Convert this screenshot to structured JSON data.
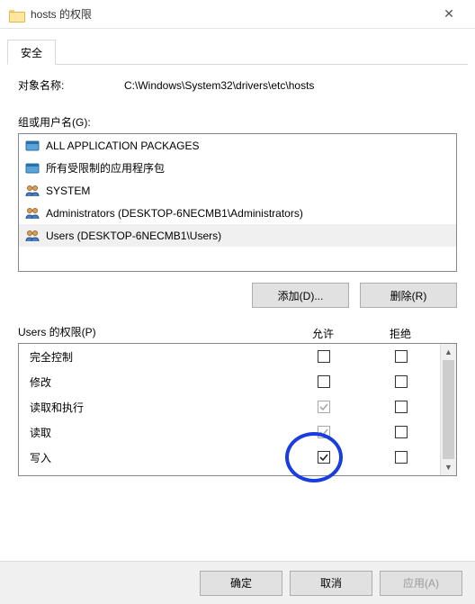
{
  "window": {
    "title": "hosts 的权限",
    "close_glyph": "✕"
  },
  "tabs": {
    "security": "安全"
  },
  "object": {
    "label": "对象名称:",
    "path": "C:\\Windows\\System32\\drivers\\etc\\hosts"
  },
  "groups": {
    "label": "组或用户名(G):",
    "items": [
      {
        "name": "ALL APPLICATION PACKAGES",
        "icon": "package"
      },
      {
        "name": "所有受限制的应用程序包",
        "icon": "package"
      },
      {
        "name": "SYSTEM",
        "icon": "users"
      },
      {
        "name": "Administrators (DESKTOP-6NECMB1\\Administrators)",
        "icon": "users"
      },
      {
        "name": "Users (DESKTOP-6NECMB1\\Users)",
        "icon": "users",
        "selected": true
      }
    ],
    "add_btn": "添加(D)...",
    "remove_btn": "删除(R)"
  },
  "perms": {
    "label": "Users 的权限(P)",
    "col_allow": "允许",
    "col_deny": "拒绝",
    "rows": [
      {
        "name": "完全控制",
        "allow": false,
        "deny": false,
        "disabled": false
      },
      {
        "name": "修改",
        "allow": false,
        "deny": false,
        "disabled": false
      },
      {
        "name": "读取和执行",
        "allow": true,
        "deny": false,
        "disabled": true
      },
      {
        "name": "读取",
        "allow": true,
        "deny": false,
        "disabled": true
      },
      {
        "name": "写入",
        "allow": true,
        "deny": false,
        "disabled": false
      }
    ],
    "scroll_up": "▲",
    "scroll_down": "▼"
  },
  "footer": {
    "ok": "确定",
    "cancel": "取消",
    "apply": "应用(A)"
  }
}
